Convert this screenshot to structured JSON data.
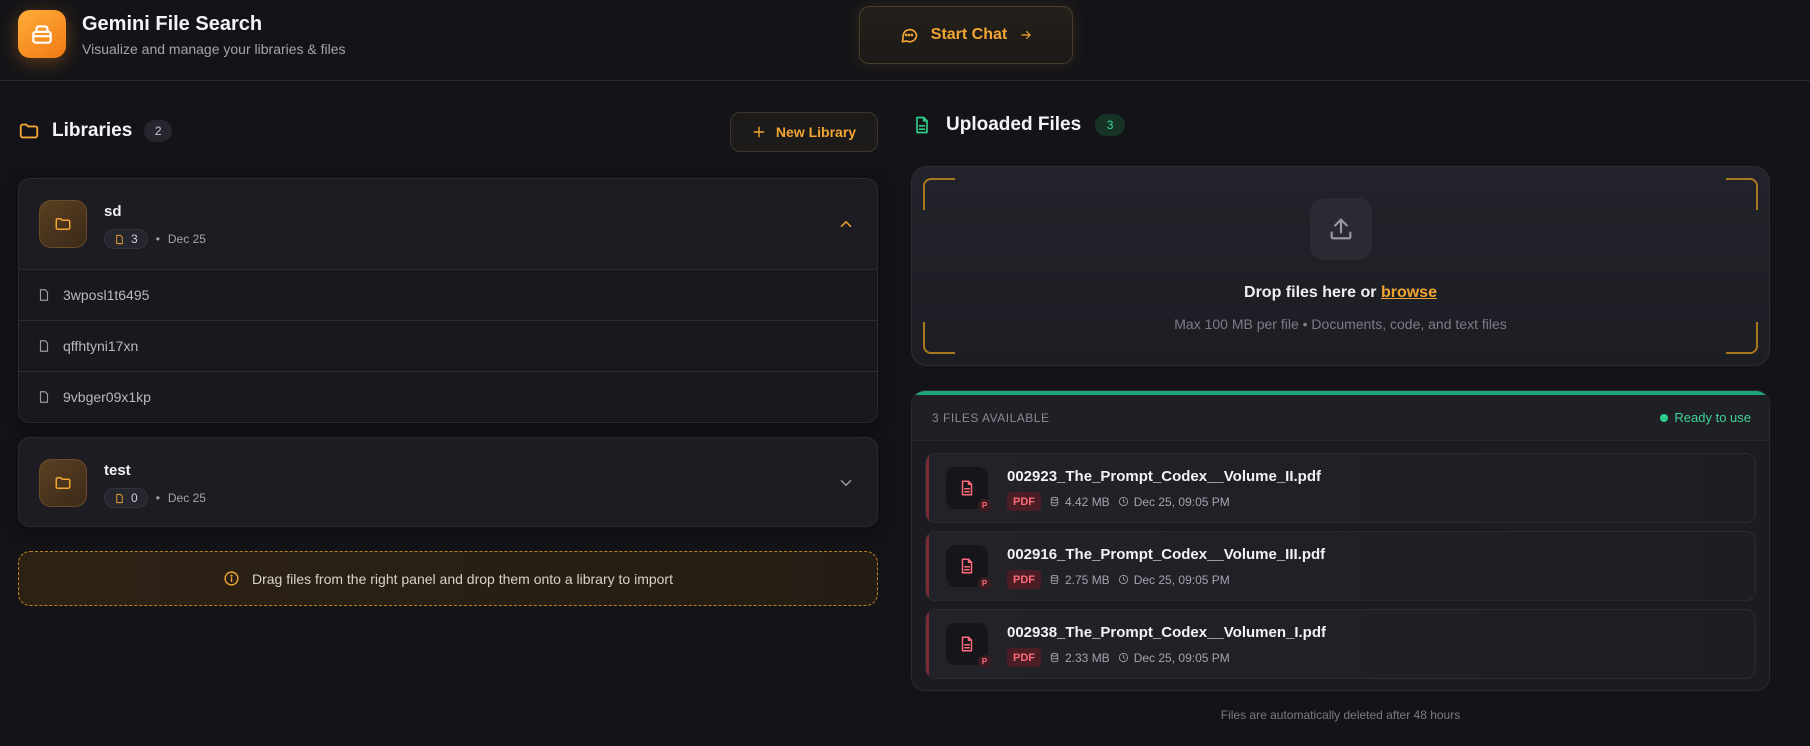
{
  "app": {
    "title": "Gemini File Search",
    "subtitle": "Visualize and manage your libraries & files",
    "start_chat_label": "Start Chat"
  },
  "colors": {
    "accent": "#f2a533",
    "success": "#3fd493",
    "pdf": "#ff6b7a",
    "background": "#141418"
  },
  "libraries": {
    "title": "Libraries",
    "count": "2",
    "new_library_label": "New Library",
    "items": [
      {
        "name": "sd",
        "file_count": "3",
        "date": "Dec 25",
        "expanded": true,
        "files": [
          "3wposl1t6495",
          "qffhtyni17xn",
          "9vbger09x1kp"
        ]
      },
      {
        "name": "test",
        "file_count": "0",
        "date": "Dec 25",
        "expanded": false,
        "files": []
      }
    ],
    "drag_hint": "Drag files from the right panel and drop them onto a library to import"
  },
  "uploads": {
    "title": "Uploaded Files",
    "count": "3",
    "drop_title_prefix": "Drop files here or",
    "browse_label": "browse",
    "drop_subtitle": "Max 100 MB per file • Documents, code, and text files",
    "files_available": "3 FILES AVAILABLE",
    "ready_label": "Ready to use",
    "files": [
      {
        "name": "002923_The_Prompt_Codex__Volume_II.pdf",
        "type": "PDF",
        "badge_letter": "P",
        "size": "4.42 MB",
        "date": "Dec 25, 09:05 PM"
      },
      {
        "name": "002916_The_Prompt_Codex__Volume_III.pdf",
        "type": "PDF",
        "badge_letter": "P",
        "size": "2.75 MB",
        "date": "Dec 25, 09:05 PM"
      },
      {
        "name": "002938_The_Prompt_Codex__Volumen_I.pdf",
        "type": "PDF",
        "badge_letter": "P",
        "size": "2.33 MB",
        "date": "Dec 25, 09:05 PM"
      }
    ],
    "footer_note": "Files are automatically deleted after 48 hours"
  }
}
